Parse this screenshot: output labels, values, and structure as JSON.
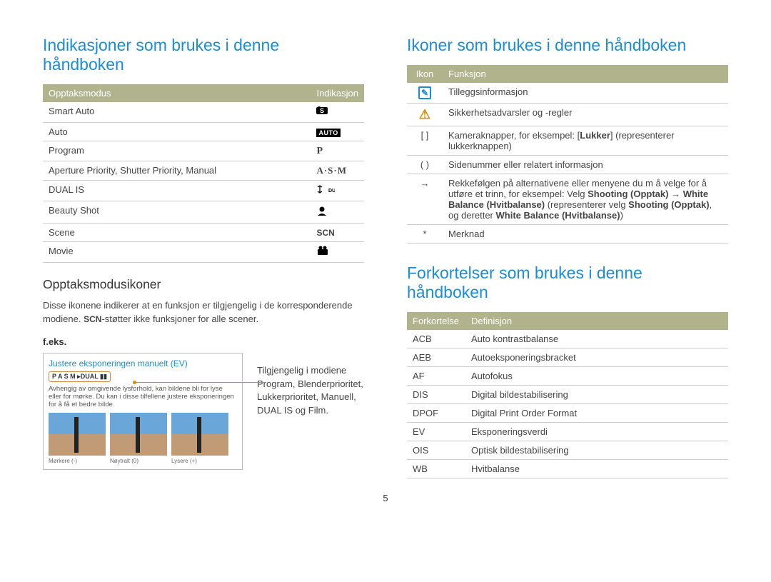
{
  "page_number": "5",
  "left": {
    "heading": "Indikasjoner som brukes i denne håndboken",
    "table": {
      "headers": [
        "Opptaksmodus",
        "Indikasjon"
      ],
      "rows": [
        {
          "mode": "Smart Auto",
          "kind": "smart-auto"
        },
        {
          "mode": "Auto",
          "kind": "auto-badge",
          "label": "AUTO"
        },
        {
          "mode": "Program",
          "kind": "p-text",
          "label": "P"
        },
        {
          "mode": "Aperture Priority, Shutter Priority, Manual",
          "kind": "asm-text",
          "label": "A·S·M"
        },
        {
          "mode": "DUAL IS",
          "kind": "dual-is"
        },
        {
          "mode": "Beauty Shot",
          "kind": "beauty"
        },
        {
          "mode": "Scene",
          "kind": "scn-text",
          "label": "SCN"
        },
        {
          "mode": "Movie",
          "kind": "movie"
        }
      ]
    },
    "subheading": "Opptaksmodusikoner",
    "desc_pre": "Disse ikonene indikerer at en funksjon er tilgjengelig i de korresponderende modiene. ",
    "desc_scn": "SCN",
    "desc_post": "-støtter ikke funksjoner for alle scener.",
    "example_label": "f.eks.",
    "example": {
      "title": "Justere eksponeringen manuelt (EV)",
      "modes_strip": "P A S M ▸DUAL ▮▮",
      "body": "Avhengig av omgivende lysforhold, kan bildene bli for lyse eller for mørke. Du kan i disse tilfellene justere eksponeringen for å få et bedre bilde.",
      "captions": [
        "Mørkere (-)",
        "Nøytralt (0)",
        "Lysere (+)"
      ]
    },
    "example_side": "Tilgjengelig i modiene Program, Blenderprioritet, Lukkerprioritet, Manuell, DUAL IS og Film."
  },
  "right": {
    "heading1": "Ikoner som brukes i denne håndboken",
    "icons_table": {
      "headers": [
        "Ikon",
        "Funksjon"
      ],
      "rows": [
        {
          "icon": "info",
          "text": "Tilleggsinformasjon"
        },
        {
          "icon": "warn",
          "text": "Sikkerhetsadvarsler og -regler"
        },
        {
          "icon": "brackets",
          "symbol": "[ ]",
          "text_pre": "Kameraknapper, for eksempel: [",
          "text_bold": "Lukker",
          "text_post": "] (representerer lukkerknappen)"
        },
        {
          "icon": "parens",
          "symbol": "( )",
          "text": "Sidenummer eller relatert informasjon"
        },
        {
          "icon": "arrow",
          "symbol": "→",
          "seq_pre": "Rekkefølgen på alternativene eller menyene du m å velge for å utføre et trinn, for eksempel: Velg ",
          "seq_b1": "Shooting (Opptak)",
          "seq_mid1": " → ",
          "seq_b2": "White Balance (Hvitbalanse)",
          "seq_mid2": " (representerer velg ",
          "seq_b3": "Shooting (Opptak)",
          "seq_mid3": ", og deretter ",
          "seq_b4": "White Balance (Hvitbalanse)",
          "seq_end": ")"
        },
        {
          "icon": "star",
          "symbol": "*",
          "text": "Merknad"
        }
      ]
    },
    "heading2": "Forkortelser som brukes i denne håndboken",
    "abbr_table": {
      "headers": [
        "Forkortelse",
        "Definisjon"
      ],
      "rows": [
        {
          "a": "ACB",
          "d": "Auto kontrastbalanse"
        },
        {
          "a": "AEB",
          "d": "Autoeksponeringsbracket"
        },
        {
          "a": "AF",
          "d": "Autofokus"
        },
        {
          "a": "DIS",
          "d": "Digital bildestabilisering"
        },
        {
          "a": "DPOF",
          "d": "Digital Print Order Format"
        },
        {
          "a": "EV",
          "d": "Eksponeringsverdi"
        },
        {
          "a": "OIS",
          "d": "Optisk bildestabilisering"
        },
        {
          "a": "WB",
          "d": "Hvitbalanse"
        }
      ]
    }
  }
}
